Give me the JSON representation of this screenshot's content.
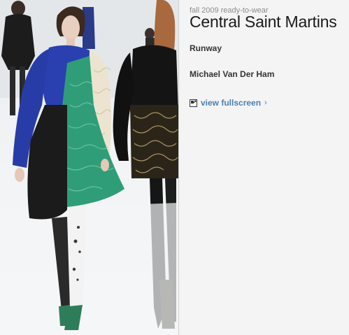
{
  "photo": {
    "alt_icon": "runway-photo"
  },
  "info": {
    "season": "fall 2009 ready-to-wear",
    "designer_house": "Central Saint Martins",
    "category": "Runway",
    "designer_name": "Michael Van Der Ham",
    "fullscreen_label": "view fullscreen",
    "fullscreen_chevron": "›"
  },
  "colors": {
    "link": "#4a7fb0",
    "panel_bg": "#f4f4f4"
  }
}
